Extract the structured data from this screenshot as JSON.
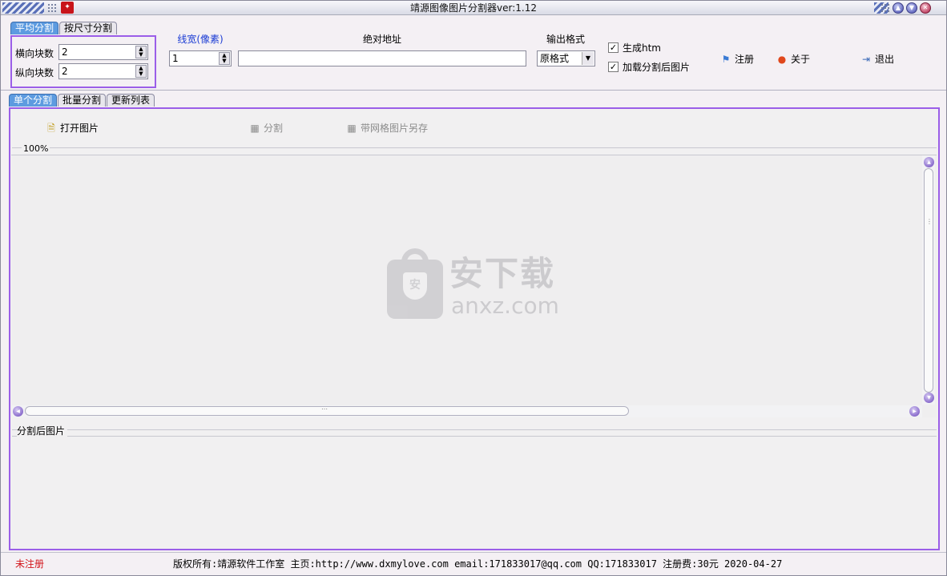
{
  "window": {
    "title": "靖源图像图片分割器ver:1.12"
  },
  "settings_tabs": [
    "平均分割",
    "按尺寸分割"
  ],
  "avg_split": {
    "h_label": "横向块数",
    "h_value": "2",
    "v_label": "纵向块数",
    "v_value": "2"
  },
  "line_width": {
    "label": "线宽(像素)",
    "value": "1"
  },
  "abs_path": {
    "label": "绝对地址",
    "value": ""
  },
  "output_format": {
    "label": "输出格式",
    "value": "原格式"
  },
  "options": {
    "gen_htm": {
      "label": "生成htm",
      "checked": true
    },
    "load_after": {
      "label": "加载分割后图片",
      "checked": true
    }
  },
  "actions": {
    "register": "注册",
    "about": "关于",
    "exit": "退出"
  },
  "main_tabs": [
    "单个分割",
    "批量分割",
    "更新列表"
  ],
  "toolbar": {
    "open": "打开图片",
    "split": "分割",
    "save_grid": "带网格图片另存"
  },
  "zoom": "100%",
  "split_section_label": "分割后图片",
  "watermark": {
    "text1": "安下载",
    "text2": "anxz.com",
    "shield": "安"
  },
  "status": {
    "unregistered": "未注册",
    "info": "版权所有:靖源软件工作室 主页:http://www.dxmylove.com email:171833017@qq.com QQ:171833017 注册费:30元 2020-04-27"
  },
  "colors": {
    "accent_border": "#9b5ee8",
    "tab_active": "#5d9be0",
    "status_red": "#d2141a",
    "label_blue": "#1a3bd4"
  }
}
